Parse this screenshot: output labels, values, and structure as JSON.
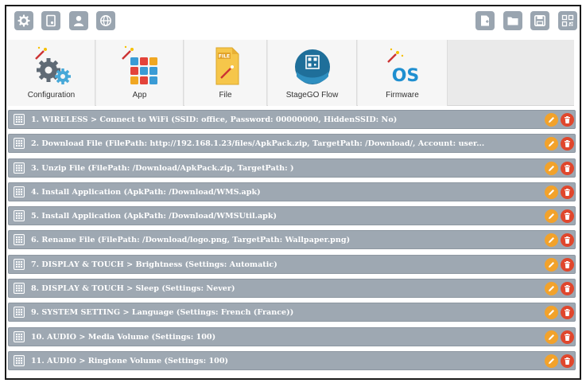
{
  "toolbar": {
    "left_icons": [
      "gear-icon",
      "device-doc-icon",
      "user-icon",
      "globe-icon"
    ],
    "right_icons": [
      "new-file-icon",
      "folder-icon",
      "save-icon",
      "qr-code-icon"
    ]
  },
  "tabs": [
    {
      "label": "Configuration",
      "icon": "gears-icon"
    },
    {
      "label": "App",
      "icon": "app-grid-icon"
    },
    {
      "label": "File",
      "icon": "file-icon"
    },
    {
      "label": "StageGO Flow",
      "icon": "stagego-qr-icon"
    },
    {
      "label": "Firmware",
      "icon": "os-icon"
    }
  ],
  "steps": [
    {
      "text": "1. WIRELESS > Connect to WiFi (SSID: office, Password: 00000000, HiddenSSID: No)"
    },
    {
      "text": "2. Download File (FilePath: http://192.168.1.23/files/ApkPack.zip, TargetPath: /Download/, Account: user..."
    },
    {
      "text": "3. Unzip File (FilePath: /Download/ApkPack.zip, TargetPath: )"
    },
    {
      "text": "4. Install Application (ApkPath: /Download/WMS.apk)"
    },
    {
      "text": "5. Install Application (ApkPath: /Download/WMSUtil.apk)"
    },
    {
      "text": "6. Rename File (FilePath: /Download/logo.png, TargetPath: Wallpaper.png)"
    },
    {
      "text": "7. DISPLAY & TOUCH > Brightness (Settings: Automatic)"
    },
    {
      "text": "8. DISPLAY & TOUCH > Sleep (Settings: Never)"
    },
    {
      "text": "9. SYSTEM SETTING > Language (Settings: French (France))"
    },
    {
      "text": "10. AUDIO > Media Volume (Settings: 100)"
    },
    {
      "text": "11. AUDIO > Ringtone Volume (Settings: 100)"
    }
  ],
  "colors": {
    "toolbar_button": "#9aa5b0",
    "step_bar": "#9ea8b2",
    "edit_button": "#f2a22b",
    "delete_button": "#e0472d"
  }
}
